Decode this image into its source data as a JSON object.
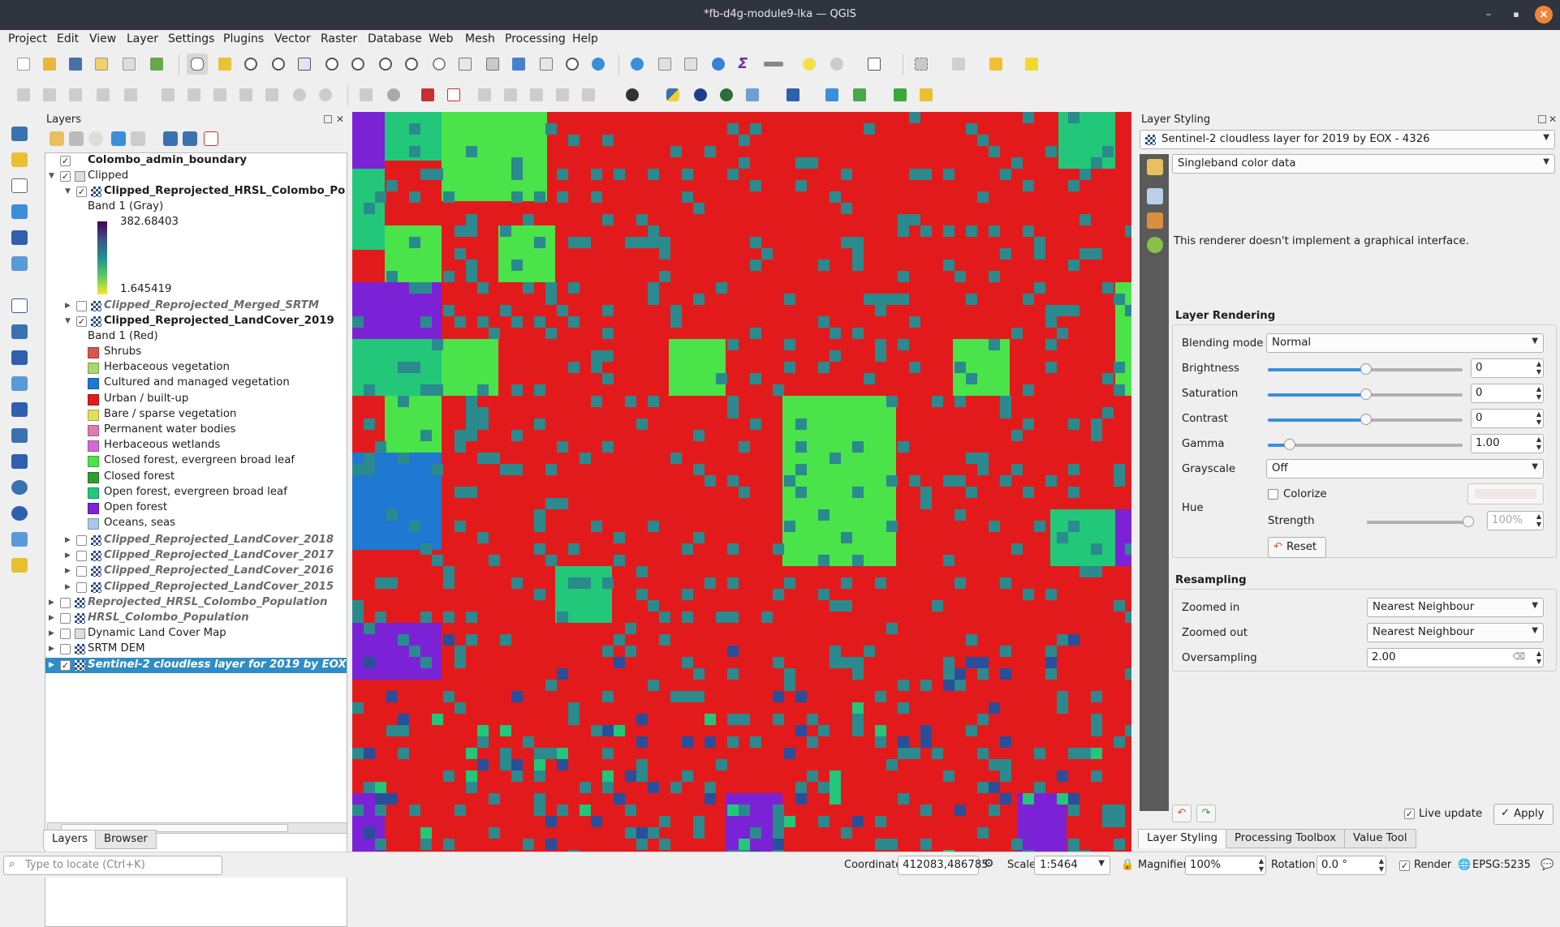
{
  "window": {
    "title": "*fb-d4g-module9-lka — QGIS",
    "minimize_glyph": "–",
    "maximize_glyph": "▪",
    "close_glyph": "×"
  },
  "menubar": [
    "Project",
    "Edit",
    "View",
    "Layer",
    "Settings",
    "Plugins",
    "Vector",
    "Raster",
    "Database",
    "Web",
    "Mesh",
    "Processing",
    "Help"
  ],
  "layers_panel": {
    "title": "Layers",
    "tabs": [
      "Layers",
      "Browser"
    ],
    "tree": [
      {
        "label": "Colombo_admin_boundary",
        "checked": true,
        "style": "bold"
      },
      {
        "label": "Clipped",
        "checked": true,
        "style": "normal"
      },
      {
        "label": "Clipped_Reprojected_HRSL_Colombo_Po",
        "checked": true,
        "style": "bold"
      },
      {
        "label": "Band 1 (Gray)",
        "style": "normal"
      },
      {
        "label": "382.68403",
        "style": "normal"
      },
      {
        "label": "1.645419",
        "style": "normal"
      },
      {
        "label": "Clipped_Reprojected_Merged_SRTM",
        "checked": false,
        "style": "ital"
      },
      {
        "label": "Clipped_Reprojected_LandCover_2019",
        "checked": true,
        "style": "bold"
      },
      {
        "label": "Band 1 (Red)",
        "style": "normal"
      }
    ],
    "legend": [
      {
        "label": "Shrubs",
        "color": "#d9534f"
      },
      {
        "label": "Herbaceous vegetation",
        "color": "#a8d86f"
      },
      {
        "label": "Cultured and managed vegetation",
        "color": "#1f78d1"
      },
      {
        "label": "Urban / built-up",
        "color": "#e31a1c"
      },
      {
        "label": "Bare / sparse vegetation",
        "color": "#e0e05a"
      },
      {
        "label": "Permanent water bodies",
        "color": "#e07ab0"
      },
      {
        "label": "Herbaceous wetlands",
        "color": "#d26ad8"
      },
      {
        "label": "Closed forest, evergreen broad leaf",
        "color": "#4ae34a"
      },
      {
        "label": "Closed forest",
        "color": "#2f9e2f"
      },
      {
        "label": "Open forest, evergreen broad leaf",
        "color": "#22c77a"
      },
      {
        "label": "Open forest",
        "color": "#7b22d6"
      },
      {
        "label": "Oceans, seas",
        "color": "#a8c8e8"
      }
    ],
    "more_layers": [
      {
        "label": "Clipped_Reprojected_LandCover_2018",
        "style": "ital",
        "indent": 2
      },
      {
        "label": "Clipped_Reprojected_LandCover_2017",
        "style": "ital",
        "indent": 2
      },
      {
        "label": "Clipped_Reprojected_LandCover_2016",
        "style": "ital",
        "indent": 2
      },
      {
        "label": "Clipped_Reprojected_LandCover_2015",
        "style": "ital",
        "indent": 2
      },
      {
        "label": "Reprojected_HRSL_Colombo_Population",
        "style": "ital",
        "indent": 1
      },
      {
        "label": "HRSL_Colombo_Population",
        "style": "ital",
        "indent": 1
      },
      {
        "label": "Dynamic Land Cover Map",
        "style": "normal",
        "indent": 1
      },
      {
        "label": "SRTM DEM",
        "style": "normal",
        "indent": 1
      },
      {
        "label": "Sentinel-2 cloudless layer for 2019 by EOX",
        "style": "selected",
        "indent": 1
      }
    ]
  },
  "styling": {
    "title": "Layer Styling",
    "layer_select": "Sentinel-2 cloudless layer for 2019 by EOX - 4326",
    "renderer": "Singleband color data",
    "renderer_message": "This renderer doesn't implement a graphical interface.",
    "rendering_title": "Layer Rendering",
    "blending_label": "Blending mode",
    "blending_value": "Normal",
    "brightness_label": "Brightness",
    "brightness_value": "0",
    "saturation_label": "Saturation",
    "saturation_value": "0",
    "contrast_label": "Contrast",
    "contrast_value": "0",
    "gamma_label": "Gamma",
    "gamma_value": "1.00",
    "grayscale_label": "Grayscale",
    "grayscale_value": "Off",
    "hue_label": "Hue",
    "colorize_label": "Colorize",
    "strength_label": "Strength",
    "strength_value": "100%",
    "reset_label": "Reset",
    "resampling_title": "Resampling",
    "zoomed_in_label": "Zoomed in",
    "zoomed_in_value": "Nearest Neighbour",
    "zoomed_out_label": "Zoomed out",
    "zoomed_out_value": "Nearest Neighbour",
    "oversampling_label": "Oversampling",
    "oversampling_value": "2.00",
    "live_update_label": "Live update",
    "apply_label": "Apply",
    "bottom_tabs": [
      "Layer Styling",
      "Processing Toolbox",
      "Value Tool"
    ]
  },
  "statusbar": {
    "locate_placeholder": "Type to locate (Ctrl+K)",
    "coordinate_label": "Coordinate",
    "coordinate_value": "412083,486785",
    "scale_label": "Scale",
    "scale_value": "1:5464",
    "magnifier_label": "Magnifier",
    "magnifier_value": "100%",
    "rotation_label": "Rotation",
    "rotation_value": "0.0 °",
    "render_label": "Render",
    "crs_label": "EPSG:5235"
  },
  "colors": {
    "urban": "#e31a1c",
    "closed_forest_evergreen": "#4ae34a",
    "open_forest_evergreen": "#22c77a",
    "open_forest": "#7b22d6",
    "cultured": "#1f78d1",
    "teal_class": "#2a8a8e",
    "selection": "#308cc6"
  }
}
